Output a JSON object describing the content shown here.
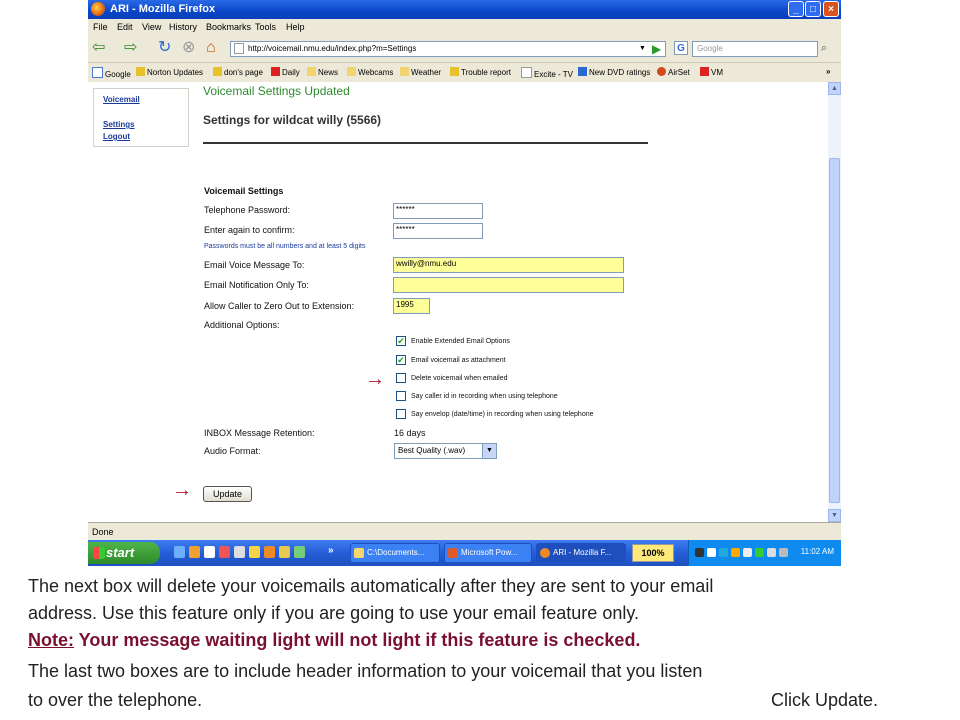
{
  "window": {
    "title": "ARI - Mozilla Firefox",
    "controls": {
      "minimize": "_",
      "maximize": "□",
      "close": "×"
    }
  },
  "menu": [
    "File",
    "Edit",
    "View",
    "History",
    "Bookmarks",
    "Tools",
    "Help"
  ],
  "nav": {
    "url": "http://voicemail.nmu.edu/index.php?m=Settings",
    "search_placeholder": "Google",
    "icons": [
      "back-icon",
      "forward-icon",
      "reload-icon",
      "stop-icon",
      "home-icon",
      "go-icon",
      "search-icon"
    ]
  },
  "bookmarks": [
    "Google",
    "Norton Updates",
    "don's page",
    "Daily",
    "News",
    "Webcams",
    "Weather",
    "Trouble report",
    "Excite - TV",
    "New DVD ratings",
    "AirSet",
    "VM"
  ],
  "bookmarks_overflow": "»",
  "sidebar": {
    "links": [
      "Voicemail",
      "Settings",
      "Logout"
    ]
  },
  "page": {
    "status_message": "Voicemail Settings Updated",
    "title": "Settings for wildcat willy (5566)",
    "section_label": "Voicemail Settings",
    "fields": {
      "telephone_password": {
        "label": "Telephone Password:",
        "value": "******"
      },
      "confirm_password": {
        "label": "Enter again to confirm:",
        "value": "******"
      },
      "password_hint": "Passwords must be all numbers and at least 5 digits",
      "email_voice_message": {
        "label": "Email Voice Message To:",
        "value": "wwilly@nmu.edu"
      },
      "email_notification": {
        "label": "Email Notification Only To:",
        "value": ""
      },
      "zero_out": {
        "label": "Allow Caller to Zero Out to Extension:",
        "value": "1995"
      }
    },
    "additional_options_label": "Additional Options:",
    "options": [
      {
        "label": "Enable Extended Email Options",
        "checked": true
      },
      {
        "label": "Email voicemail as attachment",
        "checked": true
      },
      {
        "label": "Delete voicemail when emailed",
        "checked": false
      },
      {
        "label": "Say caller id in recording when using telephone",
        "checked": false
      },
      {
        "label": "Say envelop (date/time) in recording when using telephone",
        "checked": false
      }
    ],
    "inbox_retention": {
      "label": "INBOX Message Retention:",
      "value": "16 days"
    },
    "audio_format": {
      "label": "Audio Format:",
      "value": "Best Quality (.wav)"
    },
    "update_button": "Update",
    "arrow_glyph": "→"
  },
  "statusbar": {
    "text": "Done"
  },
  "taskbar": {
    "start_label": "start",
    "quicklaunch_overflow": "»",
    "tasks": [
      "C:\\Documents...",
      "Microsoft Pow...",
      "ARI - Mozilla F..."
    ],
    "percent": "100%",
    "clock": "11:02 AM"
  },
  "caption": {
    "line1": "The next box will delete your voicemails automatically after they are sent to your email",
    "line2": "address.  Use this feature only if you are going to use your email feature only.",
    "note_label": "Note:",
    "note_text": " Your message waiting light will not light if this feature is checked.",
    "line4": "The last two boxes are to include header information to your voicemail that you listen",
    "line5a": "to over the telephone.",
    "line5b": "Click Update."
  }
}
